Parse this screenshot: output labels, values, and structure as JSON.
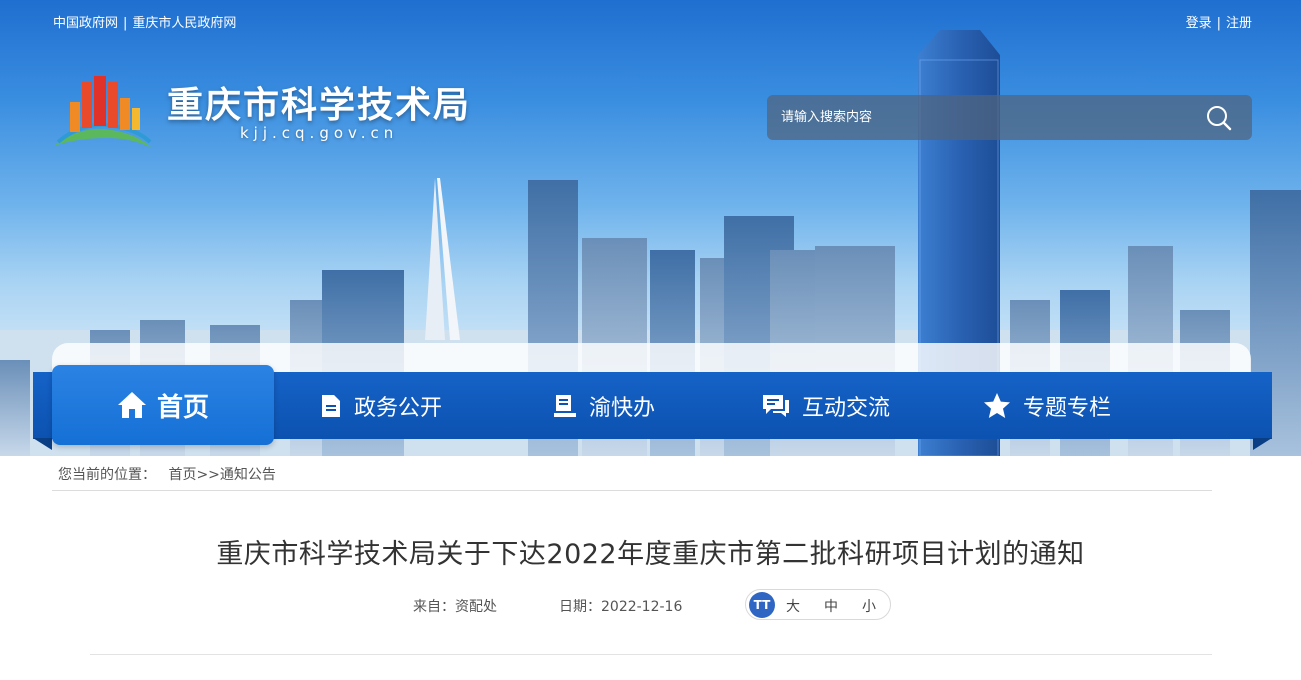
{
  "top_links": {
    "gov_cn": "中国政府网",
    "cq_gov": "重庆市人民政府网",
    "separator": "|",
    "login": "登录",
    "register": "注册"
  },
  "site": {
    "name": "重庆市科学技术局",
    "domain": "kjj.cq.gov.cn"
  },
  "search": {
    "placeholder": "请输入搜索内容",
    "icon": "search-icon"
  },
  "nav": {
    "home": "首页",
    "items": [
      {
        "label": "政务公开",
        "icon": "document-icon"
      },
      {
        "label": "渝快办",
        "icon": "service-icon"
      },
      {
        "label": "互动交流",
        "icon": "chat-icon"
      },
      {
        "label": "专题专栏",
        "icon": "star-icon"
      }
    ]
  },
  "breadcrumb": {
    "prefix": "您当前的位置：",
    "home": "首页",
    "arrow": ">>",
    "current": "通知公告"
  },
  "article": {
    "title": "重庆市科学技术局关于下达2022年度重庆市第二批科研项目计划的通知",
    "source_label": "来自：",
    "source": "资配处",
    "date_label": "日期：",
    "date": "2022-12-16"
  },
  "font_size_control": {
    "icon_text": "TT",
    "large": "大",
    "medium": "中",
    "small": "小"
  },
  "colors": {
    "nav_blue": "#0c52b0",
    "home_blue": "#1570d6",
    "title_text": "#333333"
  }
}
